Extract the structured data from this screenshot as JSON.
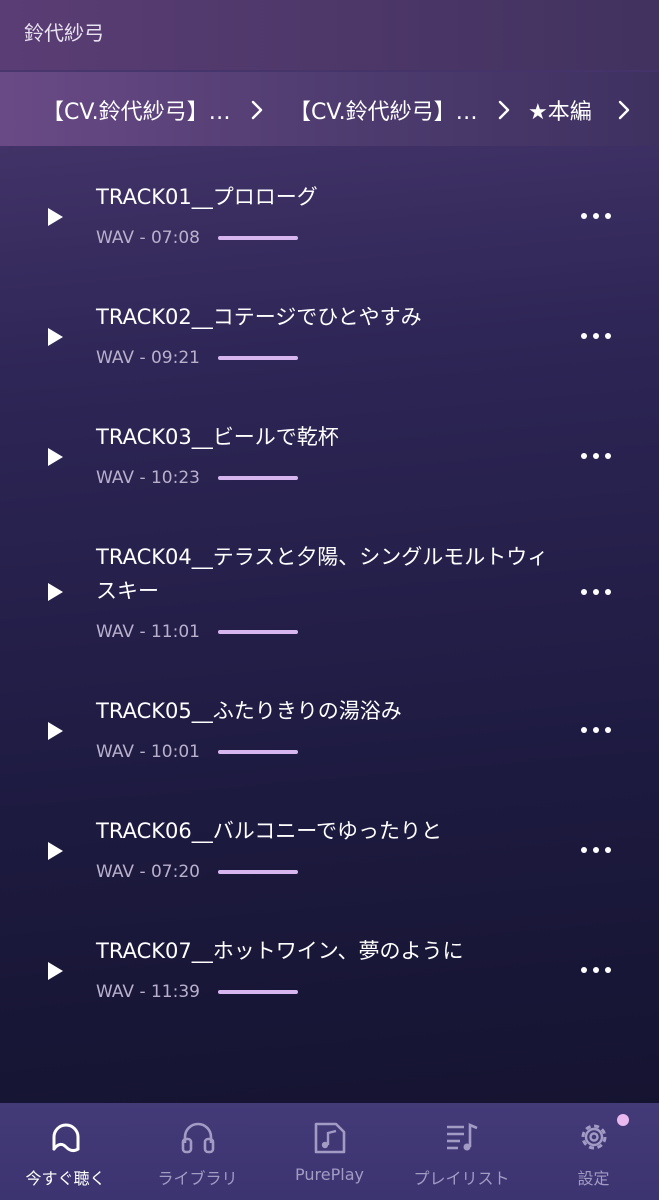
{
  "header": {
    "title": "鈴代紗弓"
  },
  "breadcrumb": {
    "items": [
      {
        "label": "【CV.鈴代紗弓】…"
      },
      {
        "label": "【CV.鈴代紗弓】…"
      },
      {
        "label": "★本編"
      }
    ]
  },
  "tracks": [
    {
      "title": "TRACK01__プロローグ",
      "meta": "WAV - 07:08"
    },
    {
      "title": "TRACK02__コテージでひとやすみ",
      "meta": "WAV - 09:21"
    },
    {
      "title": "TRACK03__ビールで乾杯",
      "meta": "WAV - 10:23"
    },
    {
      "title": "TRACK04__テラスと夕陽、シングルモルトウィスキー",
      "meta": "WAV - 11:01"
    },
    {
      "title": "TRACK05__ふたりきりの湯浴み",
      "meta": "WAV - 10:01"
    },
    {
      "title": "TRACK06__バルコニーでゆったりと",
      "meta": "WAV - 07:20"
    },
    {
      "title": "TRACK07__ホットワイン、夢のように",
      "meta": "WAV - 11:39"
    }
  ],
  "nav": {
    "items": [
      {
        "label": "今すぐ聴く",
        "icon": "listen-now-icon"
      },
      {
        "label": "ライブラリ",
        "icon": "headphones-icon"
      },
      {
        "label": "PurePlay",
        "icon": "pureplay-icon"
      },
      {
        "label": "プレイリスト",
        "icon": "playlist-icon"
      },
      {
        "label": "設定",
        "icon": "gear-icon"
      }
    ]
  },
  "colors": {
    "accent_bar": "#d7b6f0",
    "nav_bg": "#433a78",
    "badge": "#e8b8ee"
  }
}
